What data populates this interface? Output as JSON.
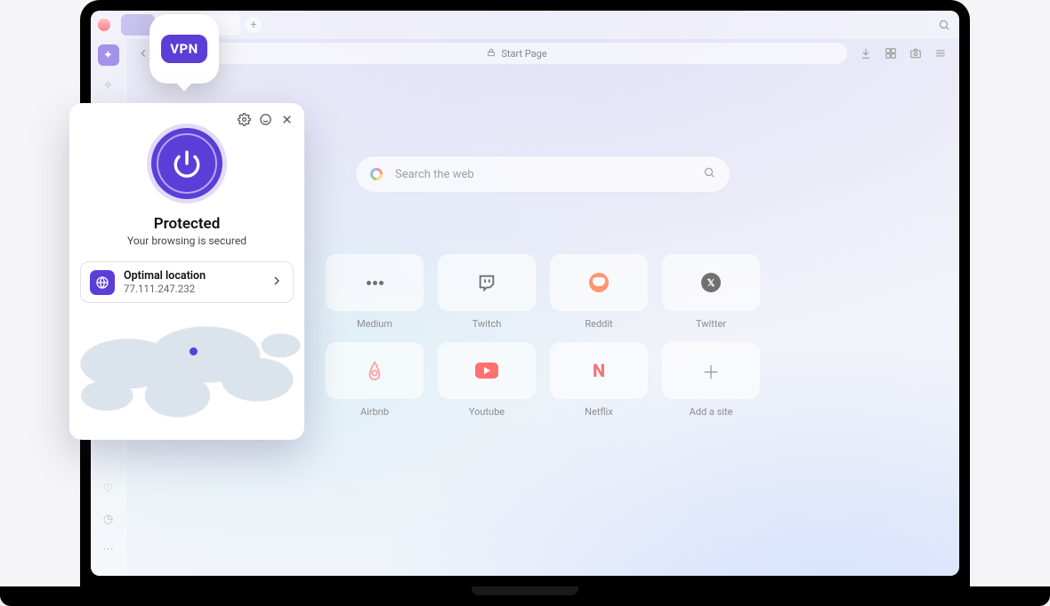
{
  "vpn_callout": {
    "label": "VPN"
  },
  "vpn_panel": {
    "status_title": "Protected",
    "status_subtitle": "Your browsing is secured",
    "location_label": "Optimal location",
    "ip": "77.111.247.232"
  },
  "address_bar": {
    "page_title": "Start Page"
  },
  "search": {
    "placeholder": "Search the web"
  },
  "speed_dial": {
    "items": [
      {
        "label": "Medium"
      },
      {
        "label": "Twitch"
      },
      {
        "label": "Reddit"
      },
      {
        "label": "Twitter"
      },
      {
        "label": "Airbnb"
      },
      {
        "label": "Youtube"
      },
      {
        "label": "Netflix"
      },
      {
        "label": "Add a site"
      }
    ]
  },
  "colors": {
    "accent": "#5b3ed8"
  }
}
